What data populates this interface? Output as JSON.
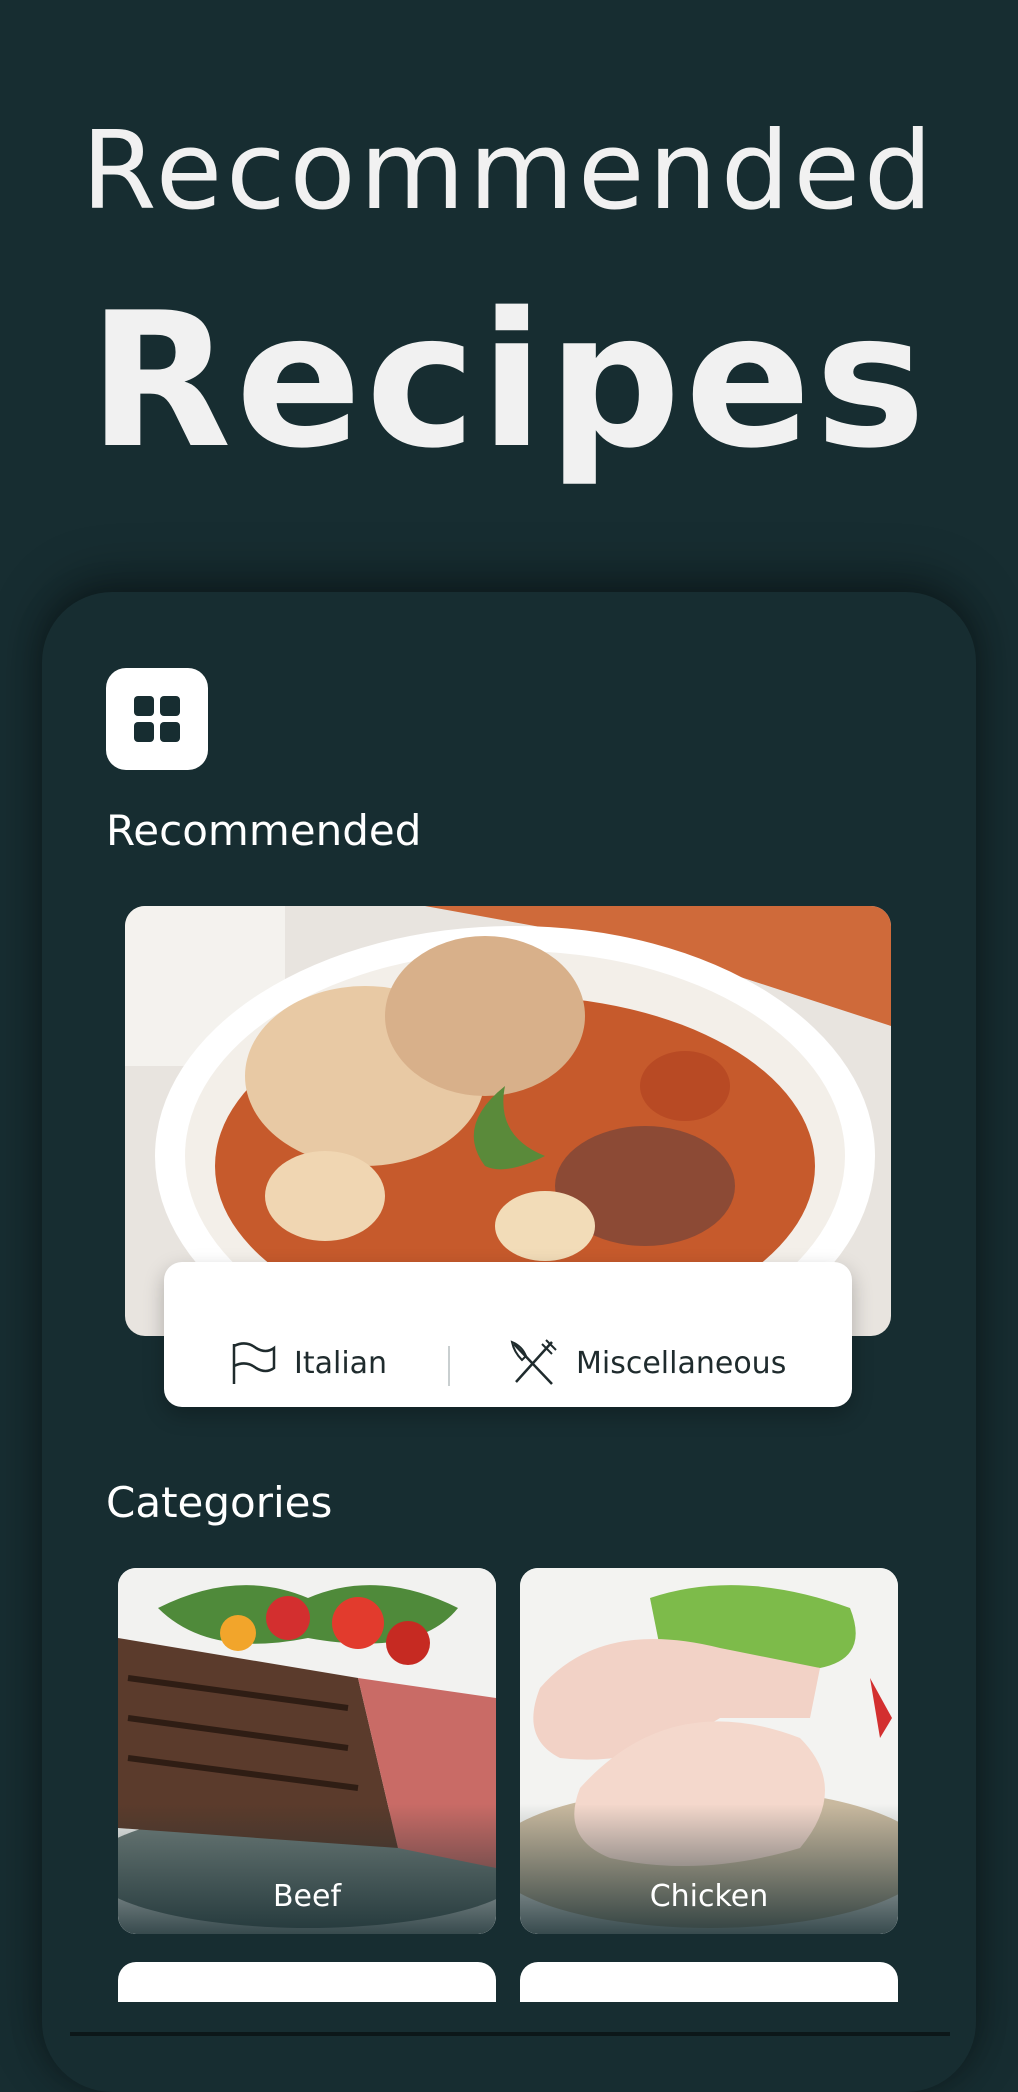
{
  "hero": {
    "line1": "Recommended",
    "line2": "Recipes"
  },
  "app": {
    "menu_icon": "grid-icon",
    "recommended_title": "Recommended",
    "recommended_recipe": {
      "cuisine": "Italian",
      "cuisine_icon": "flag-icon",
      "category": "Miscellaneous",
      "category_icon": "fork-knife-icon"
    },
    "categories_title": "Categories",
    "categories": [
      {
        "label": "Beef"
      },
      {
        "label": "Chicken"
      }
    ]
  },
  "colors": {
    "background": "#172d31",
    "card": "#ffffff",
    "text_light": "#f1f1f1",
    "text_dark": "#1f2b2d"
  }
}
